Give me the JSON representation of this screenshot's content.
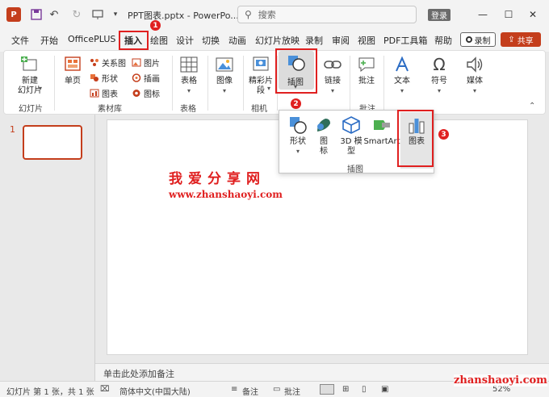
{
  "titlebar": {
    "app_logo": "P",
    "doc_title": "PPT图表.pptx  -  PowerPo...",
    "search_placeholder": "搜索",
    "login_label": "登录",
    "minimize": "—",
    "maximize": "☐",
    "close": "✕"
  },
  "tabs": {
    "file": "文件",
    "home": "开始",
    "officeplus": "OfficePLUS",
    "insert": "插入",
    "draw": "绘图",
    "design": "设计",
    "transitions": "切换",
    "animations": "动画",
    "slideshow": "幻灯片放映",
    "record": "录制",
    "review": "审阅",
    "view": "视图",
    "pdf": "PDF工具箱",
    "help": "帮助",
    "record_btn": "录制",
    "share_btn": "共享"
  },
  "ribbon": {
    "new_slide": "新建\n幻灯片",
    "slides_group": "幻灯片",
    "single_page": "单页",
    "relation_chart": "关系图",
    "shape": "形状",
    "chart_small": "图表",
    "picture_small": "图片",
    "illustration_small": "插画",
    "icon_small": "图标",
    "material_group": "素材库",
    "table": "表格",
    "table_group": "表格",
    "image": "图像",
    "album": "精彩片\n段",
    "camera_group": "相机",
    "illustrations": "插图",
    "link": "链接",
    "comment": "批注",
    "comment_group": "批注",
    "text": "文本",
    "symbol": "符号",
    "media": "媒体"
  },
  "dropdown": {
    "shapes": "形状",
    "icons": "图\n标",
    "model3d": "3D 模\n型",
    "smartart": "SmartArt",
    "chart": "图表",
    "group_label": "插图"
  },
  "badges": {
    "one": "1",
    "two": "2",
    "three": "3"
  },
  "slide_pane": {
    "slide_number": "1"
  },
  "slide": {
    "watermark_cn": "我爱分享网",
    "watermark_url": "www.zhanshaoyi.com"
  },
  "notes_placeholder": "单击此处添加备注",
  "statusbar": {
    "slide_info": "幻灯片 第 1 张，共 1 张",
    "language": "简体中文(中国大陆)",
    "notes": "备注",
    "comments": "批注",
    "zoom": "52%",
    "site": "zhanshaoyi.com"
  },
  "colors": {
    "accent": "#c43e1c",
    "highlight": "#e02020"
  }
}
